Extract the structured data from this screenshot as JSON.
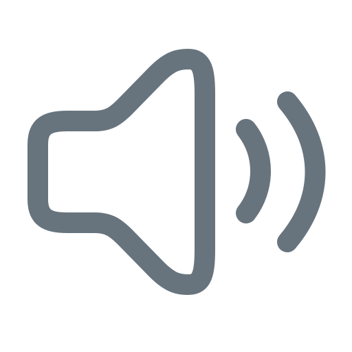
{
  "icon": {
    "name": "speaker-volume-icon",
    "color": "#68747D",
    "background": "#FFFFFF",
    "parts": [
      "speaker-body",
      "sound-wave-inner",
      "sound-wave-outer"
    ]
  }
}
